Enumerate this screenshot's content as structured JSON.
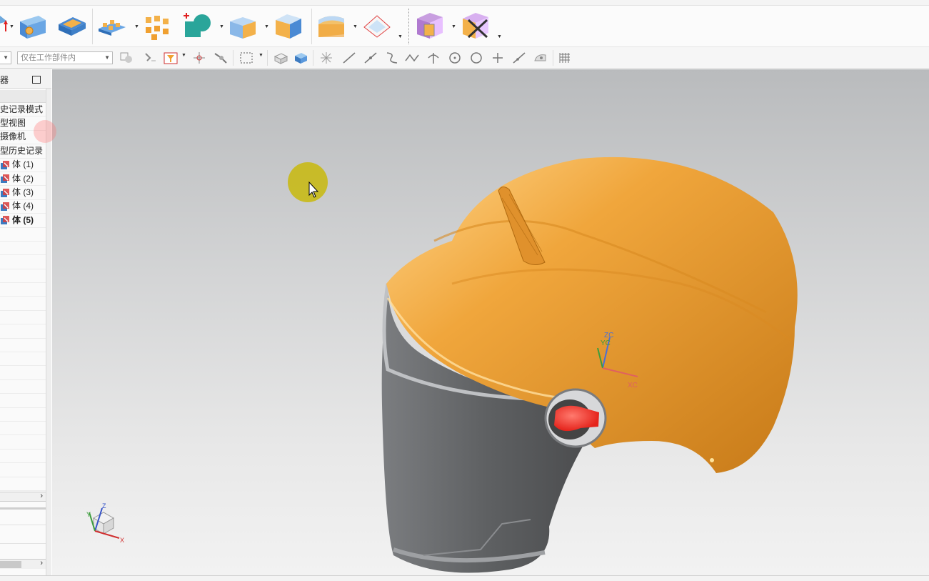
{
  "selection_bar": {
    "scope_filter": "仅在工作部件内"
  },
  "navigator": {
    "title_fragment": "器",
    "rows": [
      {
        "label": "史记录模式",
        "bold": false,
        "has_icon": false
      },
      {
        "label": "型视图",
        "bold": false,
        "has_icon": false
      },
      {
        "label": "摄像机",
        "bold": false,
        "has_icon": false
      },
      {
        "label": "型历史记录",
        "bold": false,
        "has_icon": false
      },
      {
        "label": "体 (1)",
        "bold": false,
        "has_icon": true
      },
      {
        "label": "体 (2)",
        "bold": false,
        "has_icon": true
      },
      {
        "label": "体 (3)",
        "bold": false,
        "has_icon": true
      },
      {
        "label": "体 (4)",
        "bold": false,
        "has_icon": true
      },
      {
        "label": "体 (5)",
        "bold": true,
        "has_icon": true
      }
    ]
  },
  "viewport": {
    "csys_labels": {
      "zc": "ZC",
      "yc": "YC",
      "xc": "XC"
    },
    "triad_labels": {
      "z": "Z",
      "y": "Y",
      "x": "X"
    },
    "colors": {
      "shell": "#f0a63c",
      "visor": "#5e6062",
      "knob": "#e5231b",
      "cursor_highlight": "#c8b800"
    }
  }
}
